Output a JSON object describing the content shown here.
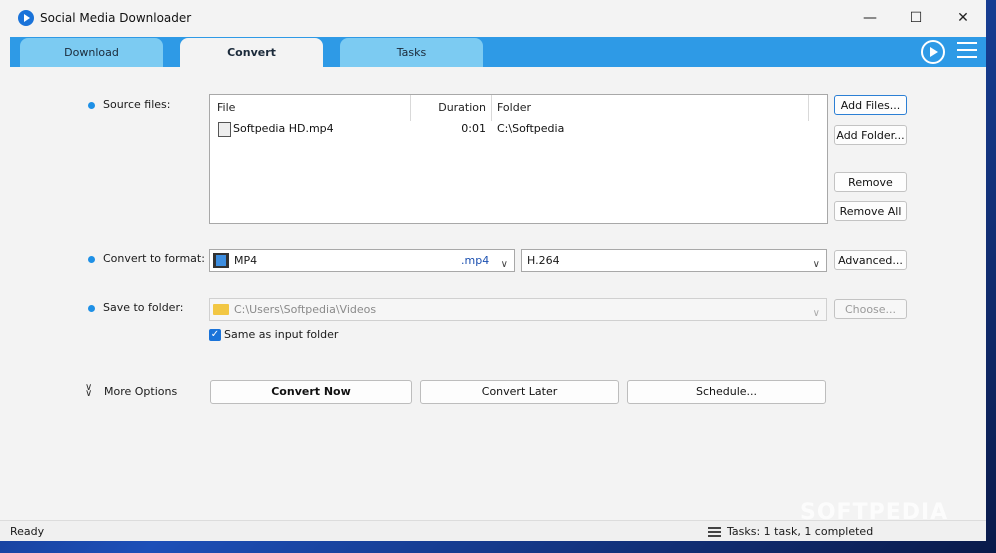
{
  "window": {
    "title": "Social Media Downloader",
    "controls": {
      "minimize": "—",
      "maximize": "☐",
      "close": "✕"
    }
  },
  "tabs": [
    {
      "label": "Download",
      "active": false
    },
    {
      "label": "Convert",
      "active": true
    },
    {
      "label": "Tasks",
      "active": false
    }
  ],
  "header_icons": [
    "play-circle-icon",
    "hamburger-menu-icon"
  ],
  "source": {
    "label": "Source files:",
    "columns": {
      "file": "File",
      "duration": "Duration",
      "folder": "Folder"
    },
    "rows": [
      {
        "file": "Softpedia HD.mp4",
        "duration": "0:01",
        "folder": "C:\\Softpedia"
      }
    ],
    "buttons": {
      "add_files": "Add Files...",
      "add_folder": "Add Folder...",
      "remove": "Remove",
      "remove_all": "Remove All"
    }
  },
  "format": {
    "label": "Convert to format:",
    "format_value": "MP4",
    "format_ext": ".mp4",
    "codec_value": "H.264",
    "advanced": "Advanced..."
  },
  "save": {
    "label": "Save to folder:",
    "folder_value": "C:\\Users\\Softpedia\\Videos",
    "choose": "Choose...",
    "same_as_input_label": "Same as input folder",
    "same_as_input_checked": true
  },
  "actions": {
    "more_options": "More Options",
    "convert_now": "Convert Now",
    "convert_later": "Convert Later",
    "schedule": "Schedule..."
  },
  "status": {
    "left": "Ready",
    "right": "Tasks: 1 task, 1 completed"
  },
  "watermark": "SOFTPEDIA",
  "colors": {
    "accent": "#2e9ae6",
    "tab_inactive": "#7ccbf2",
    "bullet": "#1e90e6"
  }
}
